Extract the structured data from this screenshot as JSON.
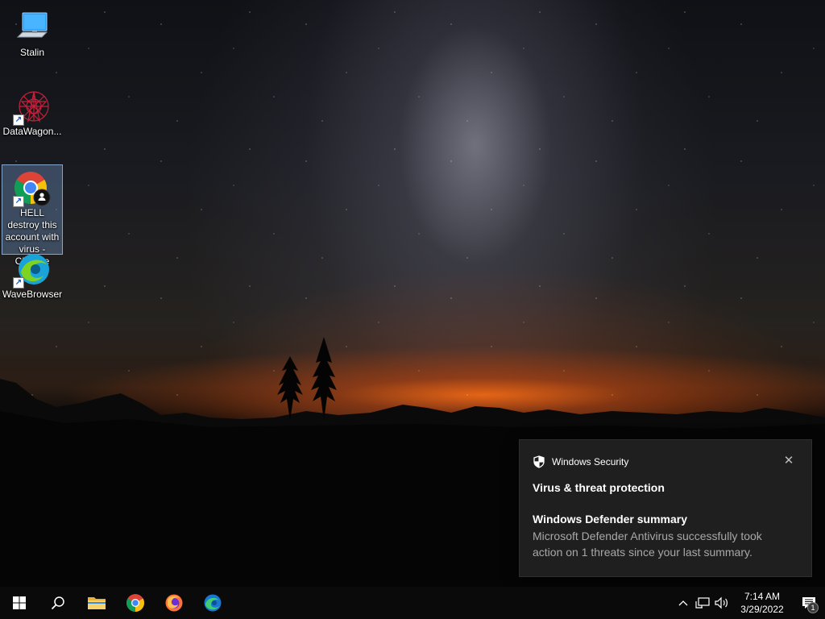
{
  "desktop": {
    "icons": [
      {
        "label": "Stalin",
        "icon": "this-pc-icon",
        "shortcut": false
      },
      {
        "label": "DataWagon...",
        "icon": "datawagon-icon",
        "shortcut": true
      },
      {
        "label": "HELL destroy this account with virus - Chrome",
        "icon": "chrome-profile-icon",
        "shortcut": true,
        "selected": true
      },
      {
        "label": "WaveBrowser",
        "icon": "wavebrowser-icon",
        "shortcut": true
      }
    ]
  },
  "toast": {
    "app_name": "Windows Security",
    "title": "Virus & threat protection",
    "subtitle": "Windows Defender summary",
    "body": "Microsoft Defender Antivirus successfully took action on 1 threats since your last summary.",
    "close_icon": "close-icon"
  },
  "taskbar": {
    "pinned": [
      "start-button",
      "search-button",
      "file-explorer",
      "chrome",
      "firefox",
      "edge"
    ],
    "tray": {
      "icons": [
        "chevron-up-icon",
        "network-icon",
        "volume-icon"
      ],
      "time": "7:14 AM",
      "date": "3/29/2022",
      "notification_count": "1"
    }
  },
  "colors": {
    "toast_bg": "#1f1f1f",
    "taskbar_bg": "#0a0a0a",
    "horizon_glow": "#ff6e14"
  }
}
